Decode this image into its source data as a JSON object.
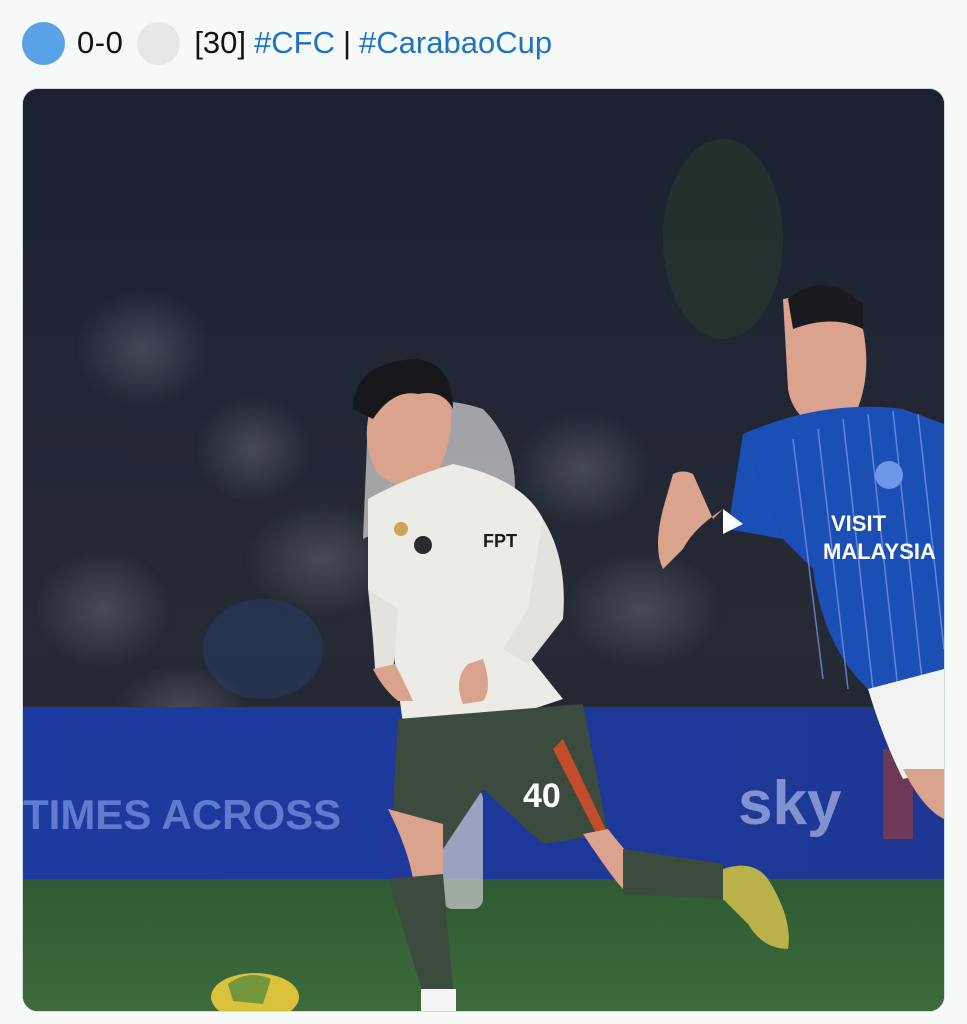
{
  "post": {
    "home_team_dot_color": "#5aa2e8",
    "away_team_dot_color": "#e6e7e9",
    "score": "0-0",
    "minute": "[30]",
    "hashtag_1": "#CFC",
    "separator": "|",
    "hashtag_2": "#CarabaoCup"
  },
  "photo": {
    "ad_board_left": "TIMES ACROSS",
    "ad_board_right": "sky",
    "player_number": "40",
    "shirt_sponsor_blue": [
      "VISIT",
      "MALAYSIA"
    ],
    "shirt_sponsor_white": "FPT"
  }
}
